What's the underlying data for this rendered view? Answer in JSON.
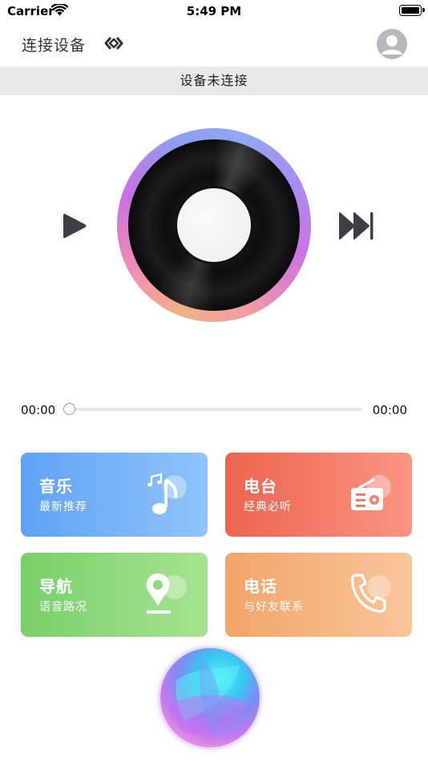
{
  "status_bar": {
    "carrier": "Carrier",
    "time": "5:49 PM"
  },
  "nav": {
    "title": "连接设备",
    "link_icon": "link-diamond-icon",
    "avatar_icon": "user-avatar-icon"
  },
  "connection": {
    "status_text": "设备未连接"
  },
  "player": {
    "current_time": "00:00",
    "total_time": "00:00",
    "progress": 0,
    "play_icon": "play-icon",
    "next_icon": "skip-forward-icon"
  },
  "cards": {
    "music": {
      "title": "音乐",
      "subtitle": "最新推荐",
      "icon": "music-note-icon"
    },
    "radio": {
      "title": "电台",
      "subtitle": "经典必听",
      "icon": "radio-icon"
    },
    "navigation": {
      "title": "导航",
      "subtitle": "语音路况",
      "icon": "location-pin-icon"
    },
    "phone": {
      "title": "电话",
      "subtitle": "与好友联系",
      "icon": "phone-icon"
    }
  },
  "assistant": {
    "icon": "voice-assistant-orb-icon"
  },
  "colors": {
    "music": "#5ea2f5",
    "radio": "#ec6450",
    "navigation": "#78d06a",
    "phone": "#f2a468",
    "connection_bar": "#e9e9ea"
  }
}
